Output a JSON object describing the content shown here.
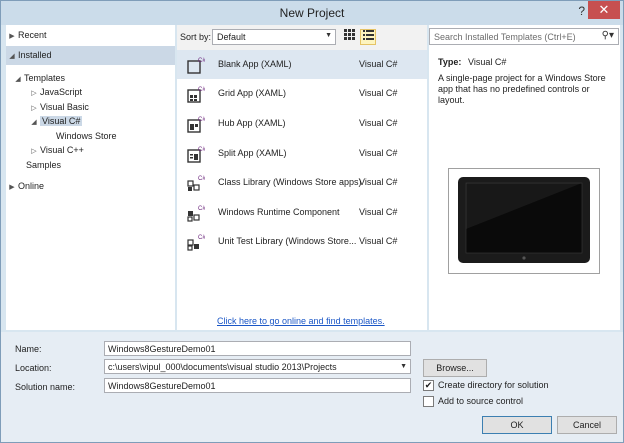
{
  "window": {
    "title": "New Project",
    "help": "?",
    "close": "✕"
  },
  "left": {
    "recent": "Recent",
    "installed": "Installed",
    "online": "Online",
    "tree": {
      "templates": "Templates",
      "javascript": "JavaScript",
      "visual_basic": "Visual Basic",
      "visual_csharp": "Visual C#",
      "windows_store": "Windows Store",
      "visual_cpp": "Visual C++",
      "samples": "Samples"
    }
  },
  "toolbar": {
    "sort_by_label": "Sort by:",
    "sort_value": "Default"
  },
  "templates": [
    {
      "name": "Blank App (XAML)",
      "lang": "Visual C#",
      "icon": "blank-app-icon",
      "selected": true
    },
    {
      "name": "Grid App (XAML)",
      "lang": "Visual C#",
      "icon": "grid-app-icon",
      "selected": false
    },
    {
      "name": "Hub App (XAML)",
      "lang": "Visual C#",
      "icon": "hub-app-icon",
      "selected": false
    },
    {
      "name": "Split App (XAML)",
      "lang": "Visual C#",
      "icon": "split-app-icon",
      "selected": false
    },
    {
      "name": "Class Library (Windows Store apps)",
      "lang": "Visual C#",
      "icon": "class-library-icon",
      "selected": false
    },
    {
      "name": "Windows Runtime Component",
      "lang": "Visual C#",
      "icon": "runtime-component-icon",
      "selected": false
    },
    {
      "name": "Unit Test Library (Windows Store...",
      "lang": "Visual C#",
      "icon": "unit-test-icon",
      "selected": false
    }
  ],
  "online_link": "Click here to go online and find templates.",
  "search": {
    "placeholder": "Search Installed Templates (Ctrl+E)"
  },
  "details": {
    "type_label": "Type:",
    "type_value": "Visual C#",
    "description": "A single-page project for a Windows Store app that has no predefined controls or layout."
  },
  "form": {
    "name_label": "Name:",
    "name_value": "Windows8GestureDemo01",
    "location_label": "Location:",
    "location_value": "c:\\users\\vipul_000\\documents\\visual studio 2013\\Projects",
    "solution_label": "Solution name:",
    "solution_value": "Windows8GestureDemo01",
    "browse": "Browse...",
    "create_dir": "Create directory for solution",
    "create_dir_checked": true,
    "add_source": "Add to source control",
    "add_source_checked": false,
    "ok": "OK",
    "cancel": "Cancel"
  },
  "colors": {
    "accent": "#68217a",
    "selection": "#cbd8e6",
    "link": "#1a56c6",
    "close": "#c75050"
  }
}
